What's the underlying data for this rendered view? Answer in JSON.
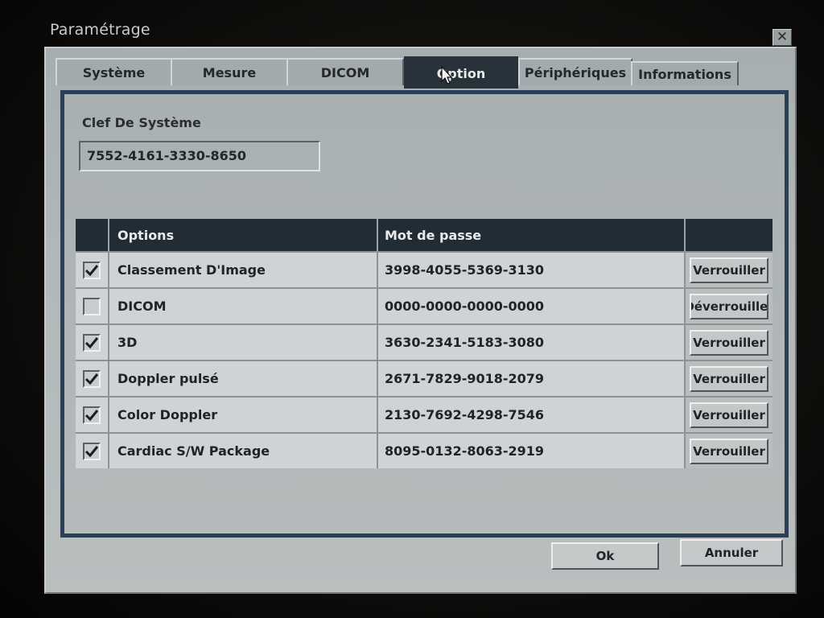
{
  "window": {
    "title": "Paramétrage",
    "close_glyph": "✕"
  },
  "tabs": [
    {
      "label": "Système",
      "active": false
    },
    {
      "label": "Mesure",
      "active": false
    },
    {
      "label": "DICOM",
      "active": false
    },
    {
      "label": "Option",
      "active": true
    },
    {
      "label": "Périphériques",
      "active": false
    },
    {
      "label": "Informations",
      "active": false
    }
  ],
  "system_key": {
    "label": "Clef De Système",
    "value": "7552-4161-3330-8650"
  },
  "table": {
    "headers": [
      "",
      "Options",
      "Mot de passe",
      ""
    ],
    "rows": [
      {
        "checked": true,
        "option": "Classement D'Image",
        "password": "3998-4055-5369-3130",
        "button": "Verrouiller"
      },
      {
        "checked": false,
        "option": "DICOM",
        "password": "0000-0000-0000-0000",
        "button": "Déverrouiller"
      },
      {
        "checked": true,
        "option": "3D",
        "password": "3630-2341-5183-3080",
        "button": "Verrouiller"
      },
      {
        "checked": true,
        "option": "Doppler pulsé",
        "password": "2671-7829-9018-2079",
        "button": "Verrouiller"
      },
      {
        "checked": true,
        "option": "Color Doppler",
        "password": "2130-7692-4298-7546",
        "button": "Verrouiller"
      },
      {
        "checked": true,
        "option": "Cardiac S/W Package",
        "password": "8095-0132-8063-2919",
        "button": "Verrouiller"
      }
    ]
  },
  "footer": {
    "ok_label": "Ok",
    "cancel_label": "Annuler"
  },
  "colors": {
    "active_tab": "#28323a",
    "panel_border": "#2a3f58",
    "header_bg": "#222c34",
    "dialog_bg": "#b2b8b9"
  },
  "icons": {
    "close": "close-icon",
    "check": "checkmark-icon",
    "cursor": "hand-cursor-icon"
  }
}
